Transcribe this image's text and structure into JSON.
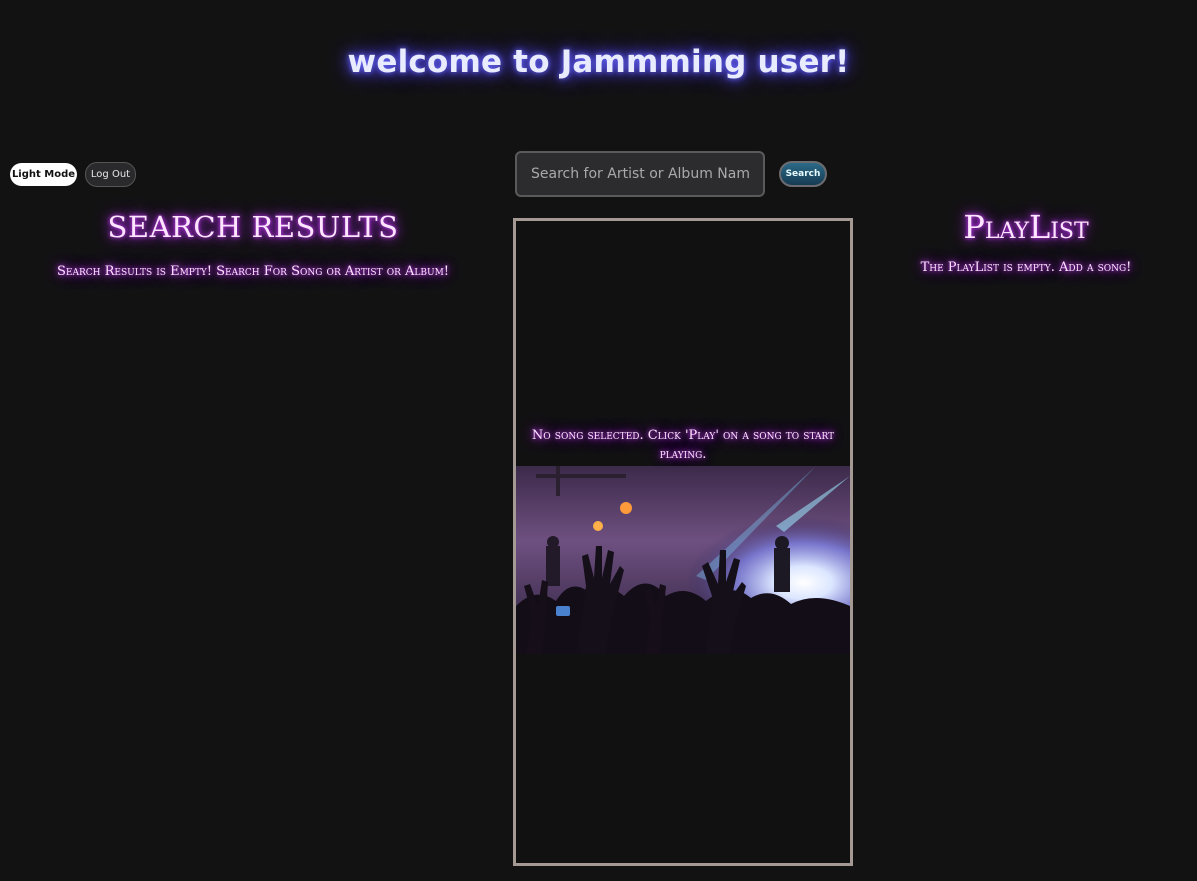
{
  "header": {
    "title": "welcome to Jammming user!"
  },
  "toolbar": {
    "light_mode_label": "Light Mode",
    "logout_label": "Log Out"
  },
  "search": {
    "placeholder": "Search for Artist or Album Name",
    "button_label": "Search"
  },
  "results": {
    "heading": "SEARCH RESULTS",
    "empty_text": "Search Results is Empty! Search For Song or Artist or Album!"
  },
  "player": {
    "message": "No song selected. Click 'Play' on a song to start playing.",
    "image_icon": "concert-crowd-image"
  },
  "playlist": {
    "heading": "PlayList",
    "empty_text": "The PlayList is empty. Add a song!"
  },
  "colors": {
    "background": "#131213",
    "title_glow": "#5a4cff",
    "heading_glow": "#d03cff",
    "panel_border": "#a59a93"
  }
}
